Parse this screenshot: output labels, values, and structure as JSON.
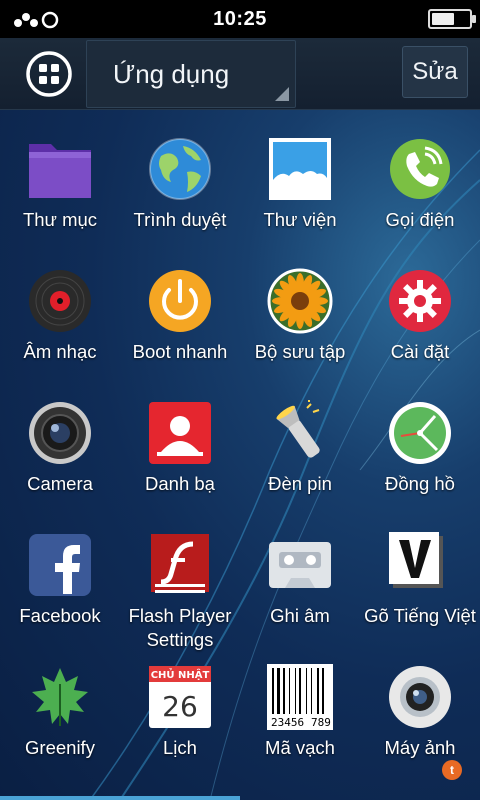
{
  "status_bar": {
    "time": "10:25",
    "battery_level_percent": 60
  },
  "header": {
    "title": "Ứng dụng",
    "edit_label": "Sửa"
  },
  "apps": [
    {
      "label": "Thư mục",
      "icon": "folder-icon",
      "color": "#7c4dc6"
    },
    {
      "label": "Trình duyệt",
      "icon": "globe-icon",
      "color": "#2e8bd8"
    },
    {
      "label": "Thư viện",
      "icon": "gallery-icon",
      "color": "#3aa0e6"
    },
    {
      "label": "Gọi điện",
      "icon": "phone-icon",
      "color": "#7bc043"
    },
    {
      "label": "Âm nhạc",
      "icon": "music-disc-icon",
      "color": "#2a2a2a"
    },
    {
      "label": "Boot nhanh",
      "icon": "power-icon",
      "color": "#f5a623"
    },
    {
      "label": "Bộ sưu tập",
      "icon": "flower-icon",
      "color": "#f39c12"
    },
    {
      "label": "Cài đặt",
      "icon": "gear-icon",
      "color": "#e0283f"
    },
    {
      "label": "Camera",
      "icon": "camera-lens-icon",
      "color": "#333333"
    },
    {
      "label": "Danh bạ",
      "icon": "contact-icon",
      "color": "#e5262f"
    },
    {
      "label": "Đèn pin",
      "icon": "flashlight-icon",
      "color": "#d8d8d8"
    },
    {
      "label": "Đồng hồ",
      "icon": "clock-icon",
      "color": "#5cb85c"
    },
    {
      "label": "Facebook",
      "icon": "facebook-icon",
      "color": "#3b5998"
    },
    {
      "label": "Flash Player Settings",
      "label_lines": [
        "Flash Player",
        "Settings"
      ],
      "icon": "flash-player-icon",
      "color": "#b81c1c"
    },
    {
      "label": "Ghi âm",
      "icon": "cassette-icon",
      "color": "#e0e4e8"
    },
    {
      "label": "Gõ Tiếng Việt",
      "icon": "v-keyboard-icon",
      "color": "#ffffff"
    },
    {
      "label": "Greenify",
      "icon": "greenify-leaf-icon",
      "color": "#4caf50"
    },
    {
      "label": "Lịch",
      "icon": "calendar-icon",
      "color": "#e33b3b",
      "calendar_day_name": "CHỦ NHẬT",
      "calendar_date": "26"
    },
    {
      "label": "Mã vạch",
      "icon": "barcode-icon",
      "color": "#ffffff",
      "barcode_digits_left": "23456",
      "barcode_digits_right": "789"
    },
    {
      "label": "Máy ảnh",
      "icon": "camera-round-icon",
      "color": "#e8e8e8"
    }
  ]
}
